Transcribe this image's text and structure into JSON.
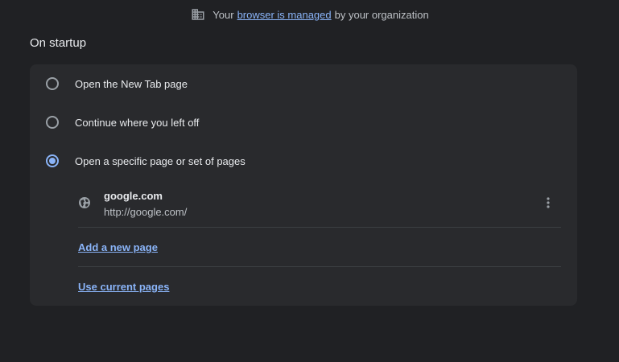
{
  "banner": {
    "prefix": "Your",
    "link_text": "browser is managed",
    "suffix": "by your organization",
    "icon": "building-icon"
  },
  "startup": {
    "title": "On startup",
    "options": [
      {
        "label": "Open the New Tab page",
        "selected": false
      },
      {
        "label": "Continue where you left off",
        "selected": false
      },
      {
        "label": "Open a specific page or set of pages",
        "selected": true
      }
    ],
    "pages": [
      {
        "name": "google.com",
        "url": "http://google.com/",
        "icon": "globe-icon"
      }
    ],
    "add_page_label": "Add a new page",
    "use_current_label": "Use current pages"
  },
  "colors": {
    "background": "#202124",
    "card": "#292a2d",
    "accent": "#8ab4f8",
    "text": "#e8eaed",
    "secondary_text": "#bdc1c6"
  }
}
